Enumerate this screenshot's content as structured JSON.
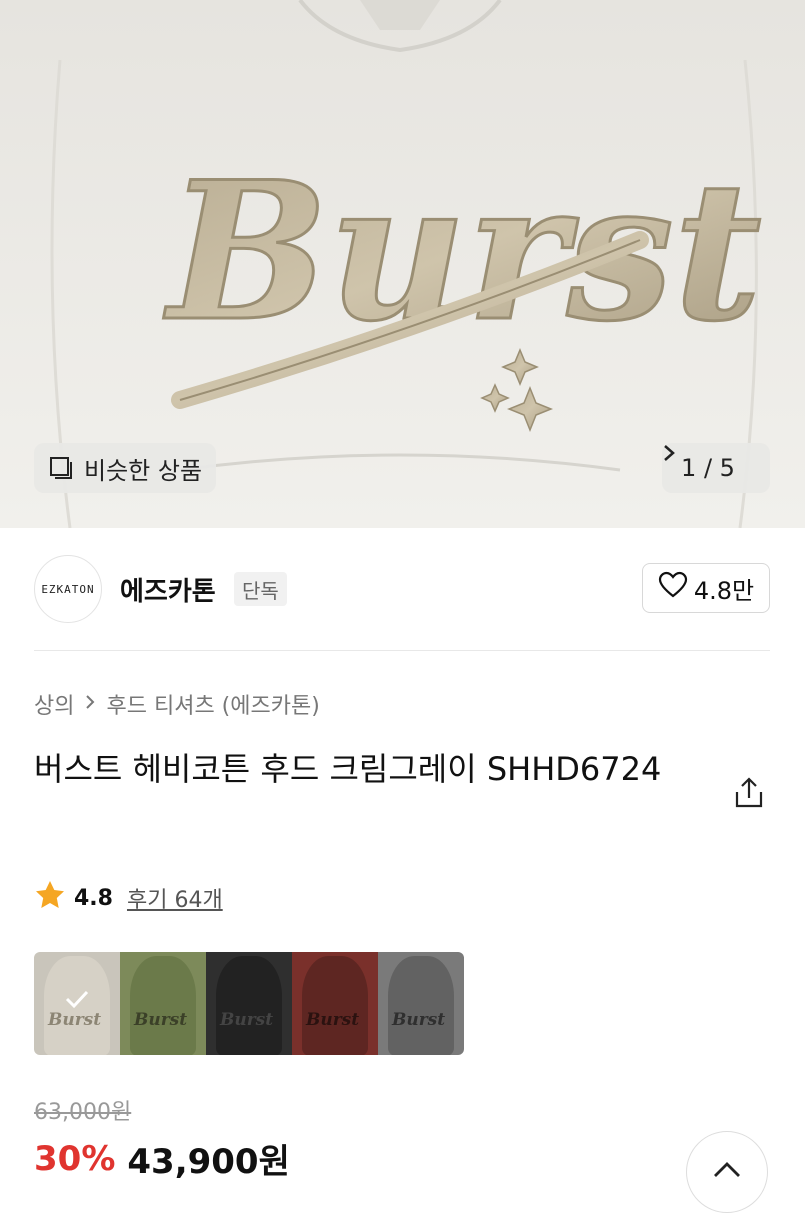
{
  "hero": {
    "similar_label": "비슷한 상품",
    "similar_icon": "similar-products-icon",
    "pager_text": "1 / 5",
    "pager_icon": "chevron-right-icon"
  },
  "brand": {
    "logo_text": "EZKATON",
    "name": "에즈카톤",
    "badge": "단독",
    "like_icon": "heart-icon",
    "like_count": "4.8만"
  },
  "breadcrumb": {
    "items": [
      "상의",
      "후드 티셔츠 (에즈카톤)"
    ],
    "separator_icon": "chevron-right-icon"
  },
  "product": {
    "title": "버스트 헤비코튼 후드 크림그레이 SHHD6724",
    "share_icon": "share-icon"
  },
  "rating": {
    "star_icon": "star-icon",
    "score": "4.8",
    "reviews": "후기 64개"
  },
  "swatches": [
    {
      "color": "#d6d1c6",
      "selected": true
    },
    {
      "color": "#6b7a4a",
      "selected": false
    },
    {
      "color": "#2a2a2a",
      "selected": false
    },
    {
      "color": "#6a2a26",
      "selected": false
    },
    {
      "color": "#6c6c6c",
      "selected": false
    }
  ],
  "price": {
    "original": "63,000원",
    "discount": "30%",
    "sale": "43,900원",
    "discount_color": "#e0342f"
  },
  "scroll_top_icon": "chevron-up-icon"
}
